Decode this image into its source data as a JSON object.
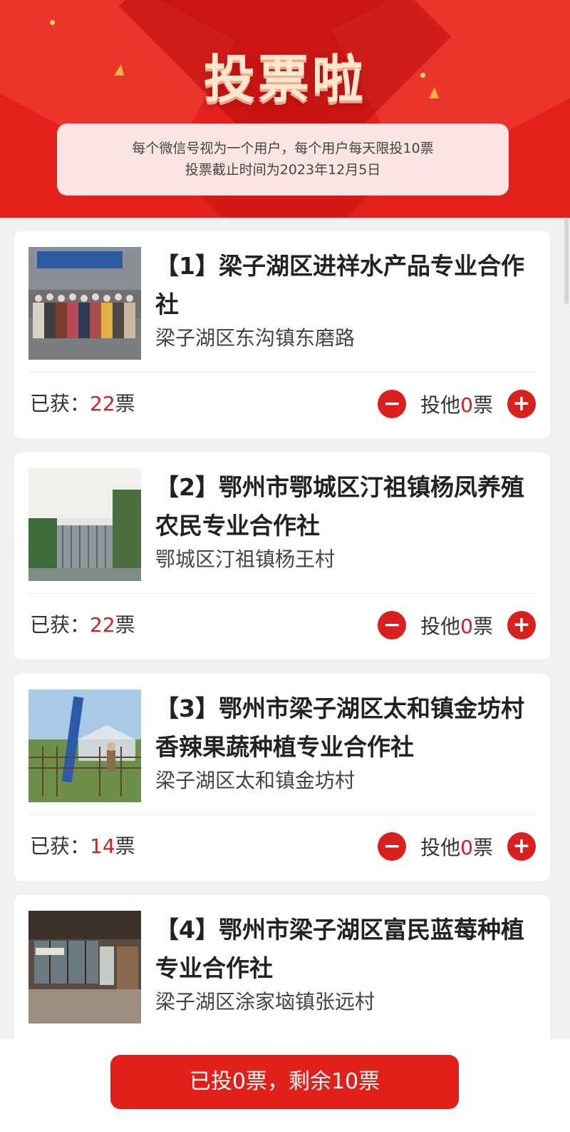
{
  "header": {
    "title": "投票啦",
    "notice_line1": "每个微信号视为一个用户，每个用户每天限投10票",
    "notice_line2": "投票截止时间为2023年12月5日"
  },
  "labels": {
    "received_prefix": "已获：",
    "ticket_unit": "票",
    "cast_prefix": "投他",
    "minus": "−",
    "plus": "+"
  },
  "items": [
    {
      "title": "【1】梁子湖区进祥水产品专业合作社",
      "address": "梁子湖区东沟镇东磨路",
      "votes": "22",
      "cast": "0"
    },
    {
      "title": "【2】鄂州市鄂城区汀祖镇杨凤养殖农民专业合作社",
      "address": "鄂城区汀祖镇杨王村",
      "votes": "22",
      "cast": "0"
    },
    {
      "title": "【3】鄂州市梁子湖区太和镇金坊村香辣果蔬种植专业合作社",
      "address": "梁子湖区太和镇金坊村",
      "votes": "14",
      "cast": "0"
    },
    {
      "title": "【4】鄂州市梁子湖区富民蓝莓种植专业合作社",
      "address": "梁子湖区涂家垴镇张远村",
      "votes": "",
      "cast": ""
    }
  ],
  "bottom": {
    "submit_label": "已投0票，剩余10票"
  }
}
